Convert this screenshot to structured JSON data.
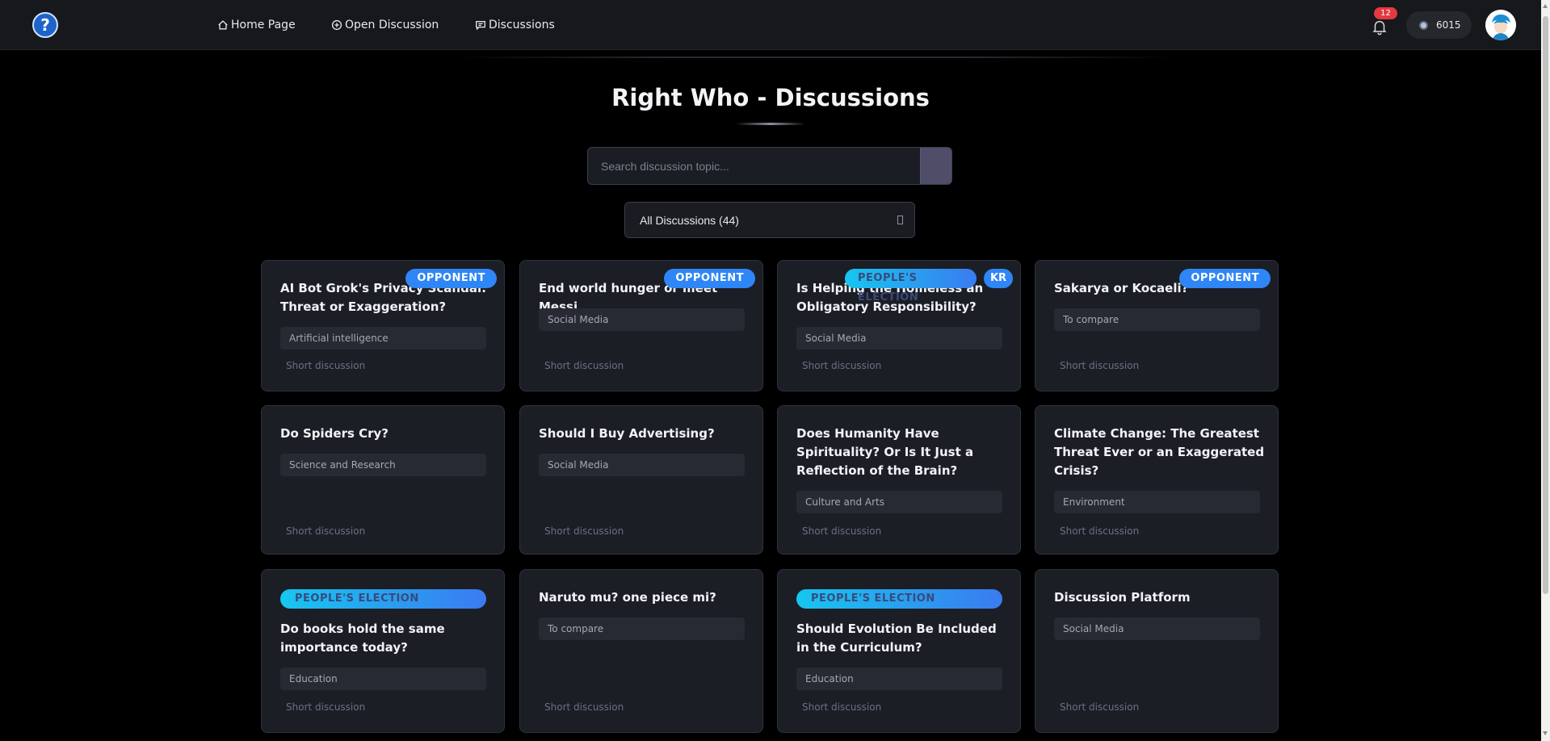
{
  "header": {
    "logo_glyph": "?",
    "nav": [
      {
        "label": "Home Page",
        "icon": "home-icon"
      },
      {
        "label": "Open Discussion",
        "icon": "plus-circle-icon"
      },
      {
        "label": "Discussions",
        "icon": "chat-icon"
      }
    ],
    "notification_count": "12",
    "coins": "6015"
  },
  "page": {
    "title": "Right Who - Discussions",
    "search_placeholder": "Search discussion topic...",
    "filter_value": "All Discussions (44)"
  },
  "colors": {
    "background": "#000000",
    "card": "#1c1e26",
    "accent_blue": "#2f86f6",
    "notification_red": "#e53940"
  },
  "cards": [
    {
      "title": "AI Bot Grok's Privacy Scandal: Threat or Exaggeration?",
      "category": "Artificial intelligence",
      "length": "Short discussion",
      "badge": "OPPONENT"
    },
    {
      "title": "End world hunger or meet Messi",
      "category": "Social Media",
      "length": "Short discussion",
      "badge": "OPPONENT"
    },
    {
      "title": "Is Helping the Homeless an Obligatory Responsibility?",
      "category": "Social Media",
      "length": "Short discussion",
      "badge": "PEOPLE'S ELECTION",
      "badge2": "KR"
    },
    {
      "title": "Sakarya or Kocaeli?",
      "category": "To compare",
      "length": "Short discussion",
      "badge": "OPPONENT"
    },
    {
      "title": "Do Spiders Cry?",
      "category": "Science and Research",
      "length": "Short discussion"
    },
    {
      "title": "Should I Buy Advertising?",
      "category": "Social Media",
      "length": "Short discussion"
    },
    {
      "title": "Does Humanity Have Spirituality? Or Is It Just a Reflection of the Brain?",
      "category": "Culture and Arts",
      "length": "Short discussion"
    },
    {
      "title": "Climate Change: The Greatest Threat Ever or an Exaggerated Crisis?",
      "category": "Environment",
      "length": "Short discussion"
    },
    {
      "title": "Do books hold the same importance today?",
      "category": "Education",
      "length": "Short discussion",
      "badge": "PEOPLE'S ELECTION"
    },
    {
      "title": "Naruto mu? one piece mi?",
      "category": "To compare",
      "length": "Short discussion"
    },
    {
      "title": "Should Evolution Be Included in the Curriculum?",
      "category": "Education",
      "length": "Short discussion",
      "badge": "PEOPLE'S ELECTION"
    },
    {
      "title": "Discussion Platform",
      "category": "Social Media",
      "length": "Short discussion"
    }
  ]
}
